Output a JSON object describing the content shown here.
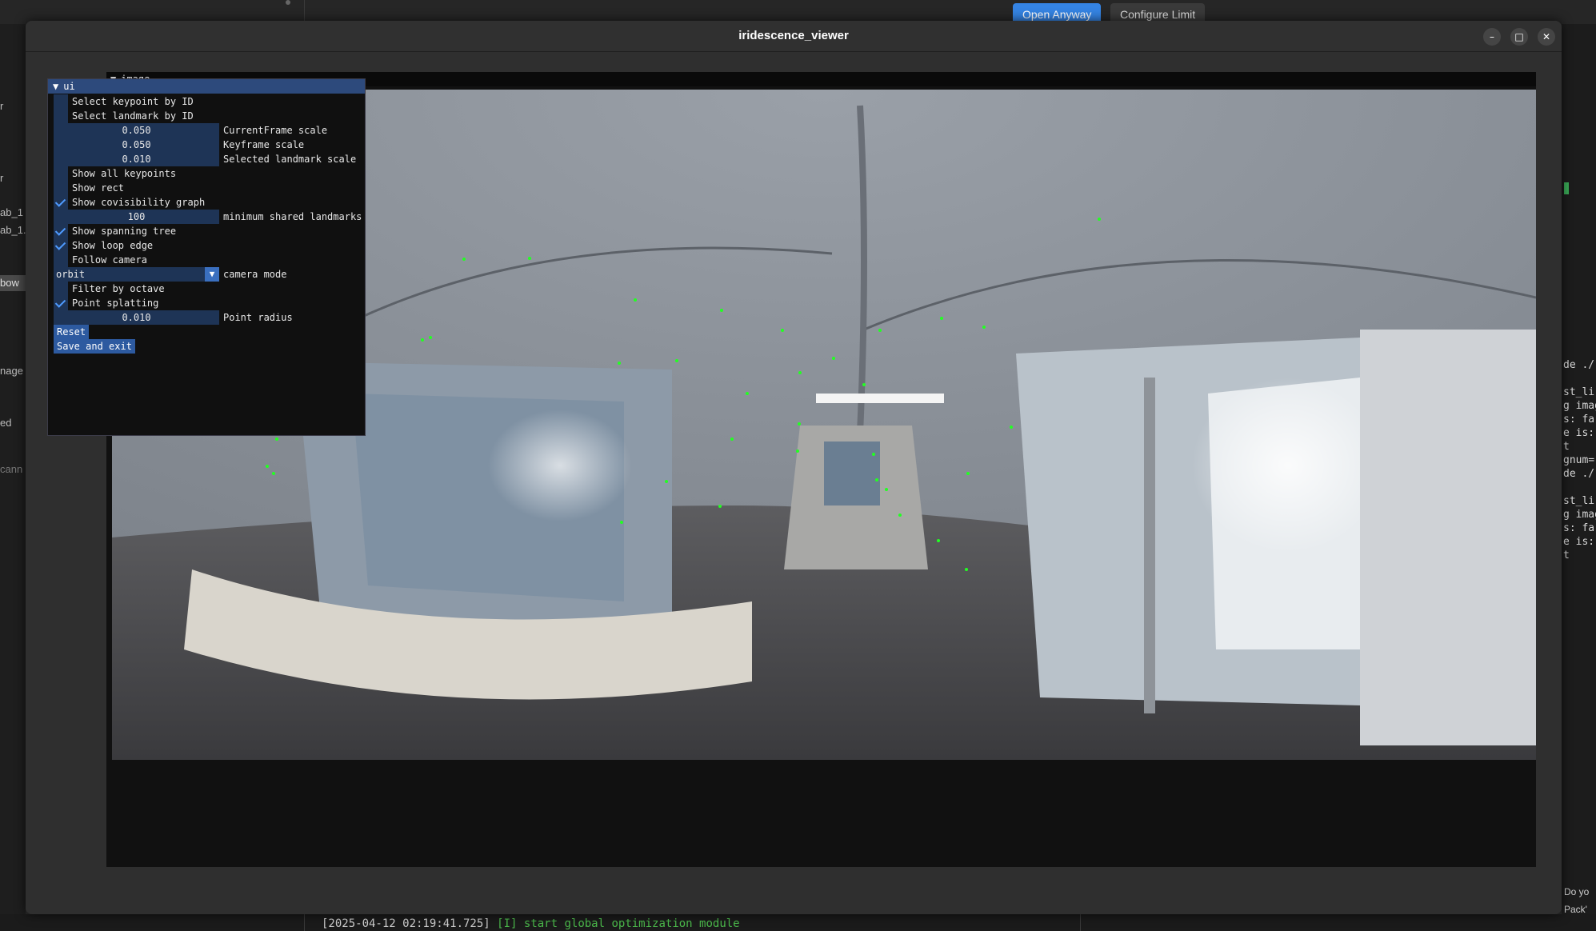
{
  "background": {
    "top_buttons": {
      "open_anyway": "Open Anyway",
      "configure_limit": "Configure Limit"
    },
    "left_items": [
      "r",
      "r",
      "ab_1",
      "ab_1.",
      "bow",
      "nage",
      "ed",
      "cann"
    ],
    "right_terminal": [
      "de ./",
      "st_li",
      "g imag",
      "s: fa",
      "e is:",
      "t",
      "gnum=",
      "de ./",
      "st_li",
      "g imag",
      "s: fa",
      "e is:",
      "t"
    ],
    "bottom_log": {
      "timestamp": "[2025-04-12 02:19:41.725]",
      "level": "[I]",
      "message": "start global optimization module"
    },
    "bottom_right": [
      "Do yo",
      "Pack'"
    ]
  },
  "window": {
    "title": "iridescence_viewer",
    "controls": {
      "minimize": "–",
      "maximize": "□",
      "close": "✕"
    }
  },
  "image_panel": {
    "title": "image",
    "collapse_glyph": "▼"
  },
  "ui_panel": {
    "title": "ui",
    "collapse_glyph": "▼",
    "select_keypoint": {
      "label": "Select keypoint by ID",
      "checked": false
    },
    "select_landmark": {
      "label": "Select landmark by ID",
      "checked": false
    },
    "current_frame_scale": {
      "value": "0.050",
      "label": "CurrentFrame scale"
    },
    "keyframe_scale": {
      "value": "0.050",
      "label": "Keyframe scale"
    },
    "selected_landmark_scale": {
      "value": "0.010",
      "label": "Selected landmark scale"
    },
    "show_all_keypoints": {
      "label": "Show all keypoints",
      "checked": false
    },
    "show_rect": {
      "label": "Show rect",
      "checked": false
    },
    "show_covisibility_graph": {
      "label": "Show covisibility graph",
      "checked": true
    },
    "min_shared_landmarks": {
      "value": "100",
      "label": "minimum shared landmarks"
    },
    "show_spanning_tree": {
      "label": "Show spanning tree",
      "checked": true
    },
    "show_loop_edge": {
      "label": "Show loop edge",
      "checked": true
    },
    "follow_camera": {
      "label": "Follow camera",
      "checked": false
    },
    "camera_mode": {
      "value": "orbit",
      "label": "camera mode"
    },
    "filter_by_octave": {
      "label": "Filter by octave",
      "checked": false
    },
    "point_splatting": {
      "label": "Point splatting",
      "checked": true
    },
    "point_radius": {
      "value": "0.010",
      "label": "Point radius"
    },
    "reset_label": "Reset",
    "save_exit_label": "Save and exit"
  },
  "colors": {
    "accent": "#3584e4",
    "imgui_header": "#2d4a7c",
    "imgui_frame": "#1e3456",
    "keypoint": "#22ff22"
  }
}
